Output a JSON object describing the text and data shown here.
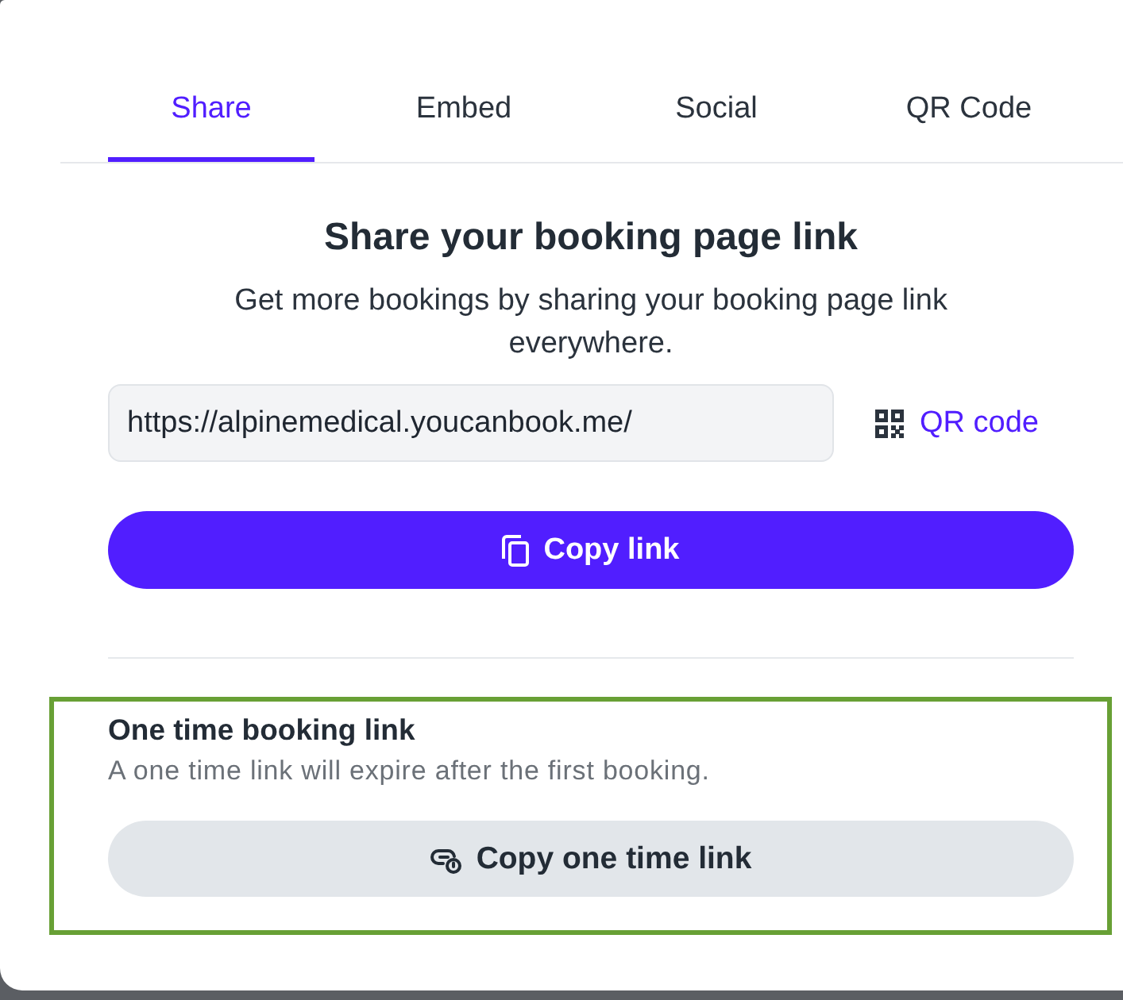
{
  "tabs": [
    {
      "label": "Share",
      "selected": true
    },
    {
      "label": "Embed",
      "selected": false
    },
    {
      "label": "Social",
      "selected": false
    },
    {
      "label": "QR Code",
      "selected": false
    }
  ],
  "share": {
    "title": "Share your booking page link",
    "description": "Get more bookings by sharing your booking page link everywhere.",
    "link_field": {
      "value": "https://alpinemedical.youcanbook.me/"
    },
    "qr_link": "QR code",
    "copy_button": "Copy link"
  },
  "one_time_link": {
    "highlighted": true,
    "title": "One time booking link",
    "description": "A one time link will expire after the first booking.",
    "copy_button": "Copy one time link"
  }
}
